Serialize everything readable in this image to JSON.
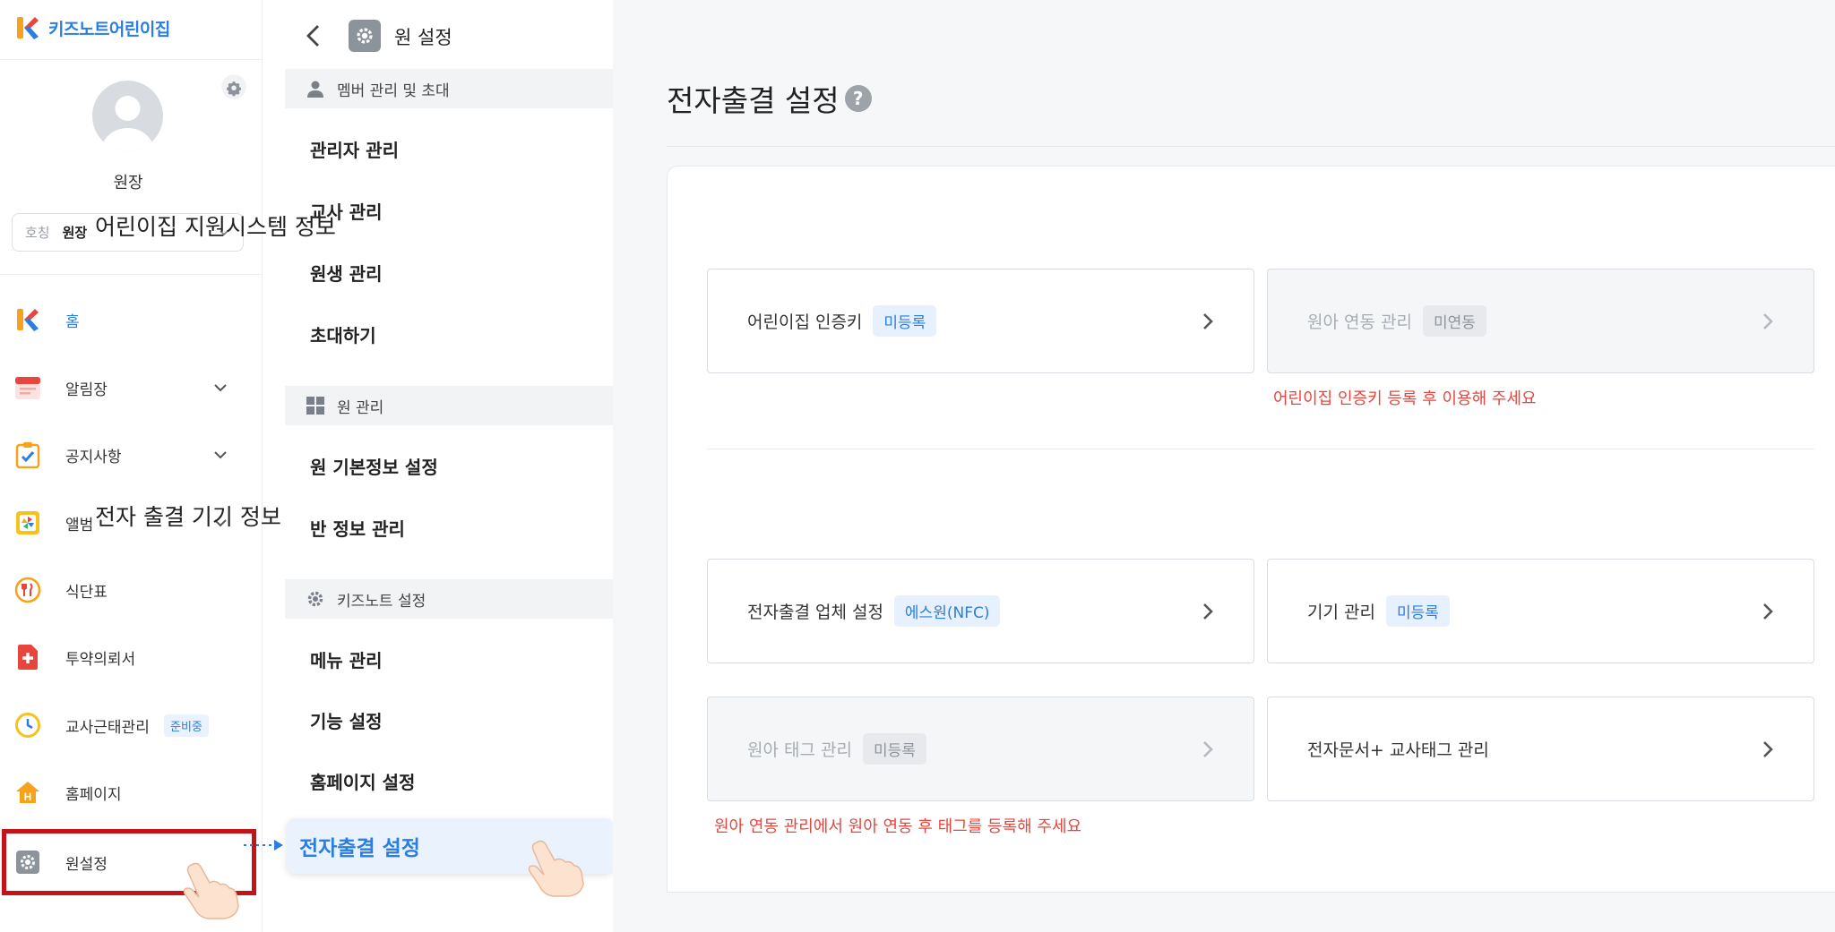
{
  "brand": {
    "name": "키즈노트어린이집"
  },
  "profile": {
    "name": "원장",
    "title_label": "호칭",
    "title_value": "원장"
  },
  "sidebar": {
    "items": [
      {
        "label": "홈",
        "icon": "kidsnote-home-icon",
        "active": true
      },
      {
        "label": "알림장",
        "icon": "notebook-icon",
        "expandable": true
      },
      {
        "label": "공지사항",
        "icon": "notice-check-icon",
        "expandable": true
      },
      {
        "label": "앨범",
        "icon": "album-icon",
        "expandable": true
      },
      {
        "label": "식단표",
        "icon": "meal-icon"
      },
      {
        "label": "투약의뢰서",
        "icon": "medicine-icon"
      },
      {
        "label": "교사근태관리",
        "icon": "clock-icon",
        "badge": "준비중"
      },
      {
        "label": "홈페이지",
        "icon": "homepage-icon"
      },
      {
        "label": "원설정",
        "icon": "settings-icon",
        "highlighted": true
      }
    ]
  },
  "submenu": {
    "title": "원 설정",
    "groups": [
      {
        "label": "멤버 관리 및 초대",
        "icon": "person-icon",
        "items": [
          "관리자 관리",
          "교사 관리",
          "원생 관리",
          "초대하기"
        ]
      },
      {
        "label": "원 관리",
        "icon": "grid-icon",
        "items": [
          "원 기본정보 설정",
          "반 정보 관리"
        ]
      },
      {
        "label": "키즈노트 설정",
        "icon": "gear-icon",
        "items": [
          "메뉴 관리",
          "기능 설정",
          "홈페이지 설정"
        ]
      }
    ],
    "active_item": "전자출결 설정"
  },
  "main": {
    "title": "전자출결 설정",
    "help_glyph": "?",
    "sections": [
      {
        "title": "어린이집 지원시스템 정보",
        "cards": [
          {
            "label": "어린이집 인증키",
            "badge": "미등록",
            "badge_style": "blue",
            "enabled": true
          },
          {
            "label": "원아 연동 관리",
            "badge": "미연동",
            "badge_style": "gray",
            "enabled": false
          }
        ],
        "warning": "어린이집 인증키 등록 후 이용해 주세요"
      },
      {
        "title": "전자 출결 기기 정보",
        "cards": [
          {
            "label": "전자출결 업체 설정",
            "badge": "에스원(NFC)",
            "badge_style": "blue",
            "enabled": true
          },
          {
            "label": "기기 관리",
            "badge": "미등록",
            "badge_style": "blue",
            "enabled": true
          },
          {
            "label": "원아 태그 관리",
            "badge": "미등록",
            "badge_style": "gray",
            "enabled": false
          },
          {
            "label": "전자문서+ 교사태그 관리",
            "enabled": true
          }
        ],
        "warning": "원아 연동 관리에서 원아 연동 후 태그를 등록해 주세요"
      }
    ]
  },
  "colors": {
    "accent": "#2a7de1",
    "warning": "#e8453c",
    "highlight_border": "#c4141a"
  }
}
